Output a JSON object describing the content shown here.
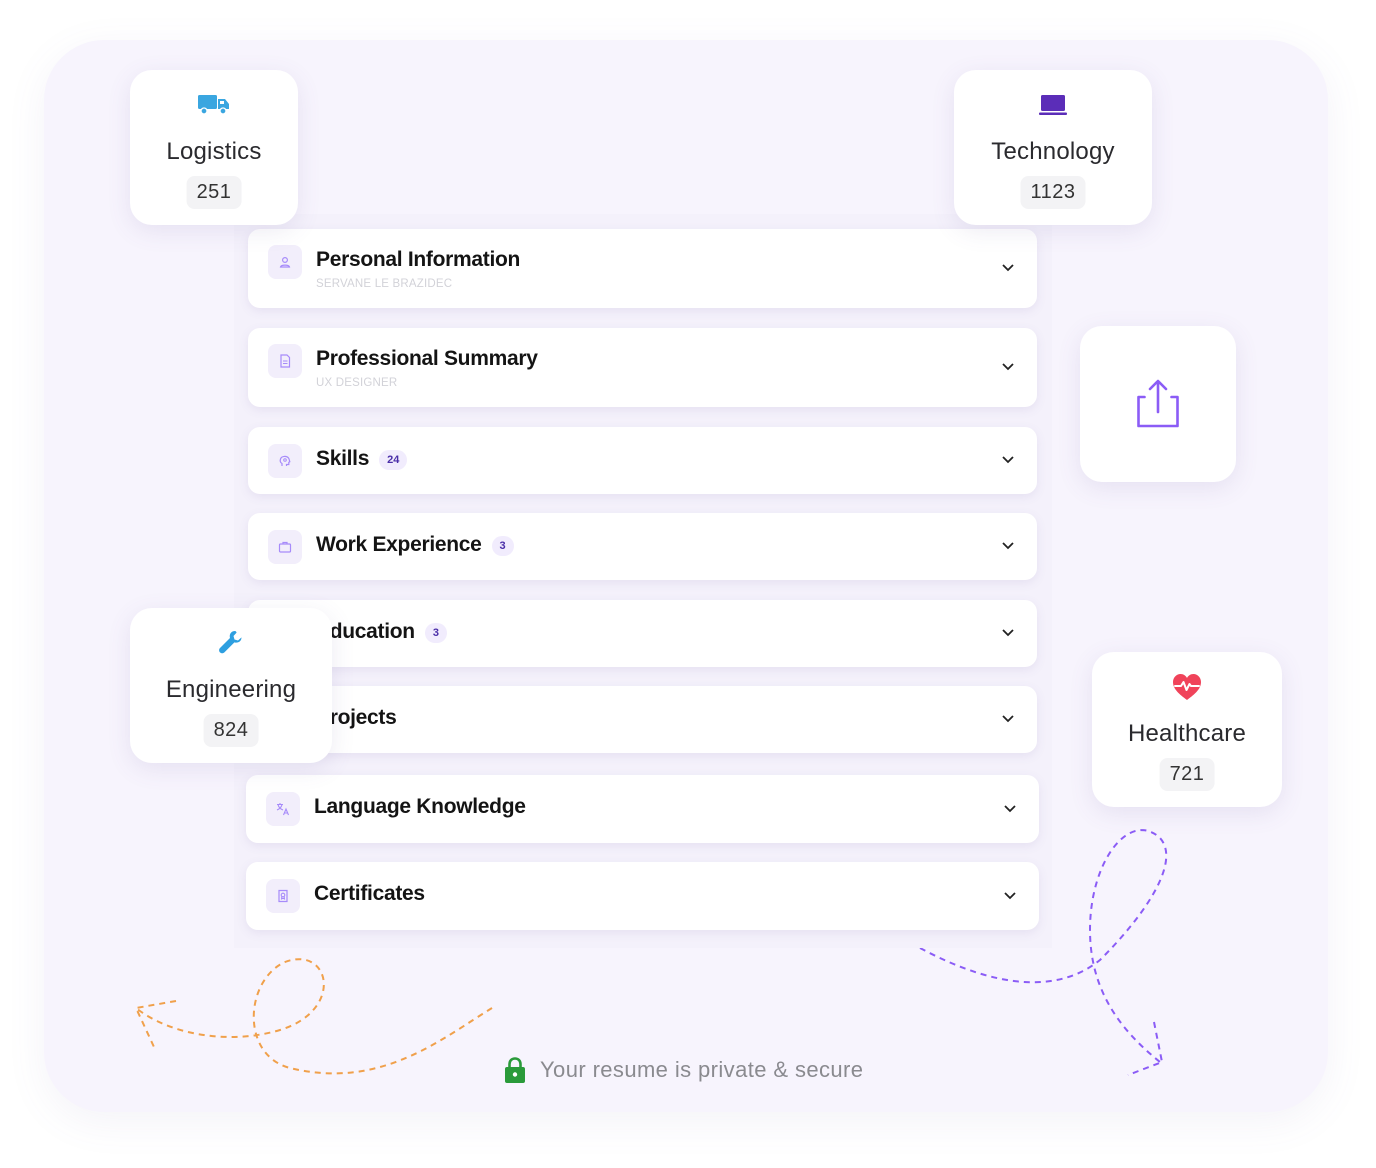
{
  "sections": [
    {
      "title": "Personal Information",
      "subtitle": "SERVANE LE BRAZIDEC",
      "icon": "user-icon"
    },
    {
      "title": "Professional Summary",
      "subtitle": "UX DESIGNER",
      "icon": "document-icon"
    },
    {
      "title": "Skills",
      "count": "24",
      "icon": "brain-icon"
    },
    {
      "title": "Work Experience",
      "count": "3",
      "icon": "briefcase-icon"
    },
    {
      "title": "Education",
      "count": "3",
      "icon": "graduation-cap-icon"
    },
    {
      "title": "Projects",
      "icon": "folder-icon"
    },
    {
      "title": "Language Knowledge",
      "icon": "translate-icon"
    },
    {
      "title": "Certificates",
      "icon": "certificate-icon"
    }
  ],
  "cards": {
    "logistics": {
      "label": "Logistics",
      "count": "251",
      "icon": "truck-icon"
    },
    "technology": {
      "label": "Technology",
      "count": "1123",
      "icon": "laptop-icon"
    },
    "engineering": {
      "label": "Engineering",
      "count": "824",
      "icon": "wrench-icon"
    },
    "healthcare": {
      "label": "Healthcare",
      "count": "721",
      "icon": "heart-pulse-icon"
    }
  },
  "share": {
    "icon": "share-icon"
  },
  "footer": {
    "text": "Your resume is private & secure",
    "icon": "lock-icon"
  },
  "colors": {
    "accent": "#8b5cf6",
    "background": "#f7f4fd",
    "logistics": "#3aa6e0",
    "technology": "#5b2db8",
    "engineering": "#2e9fe0",
    "healthcare": "#f0435a",
    "lock": "#2a9a3a",
    "doodle_orange": "#f0a04b",
    "doodle_purple": "#8b5cf6"
  }
}
